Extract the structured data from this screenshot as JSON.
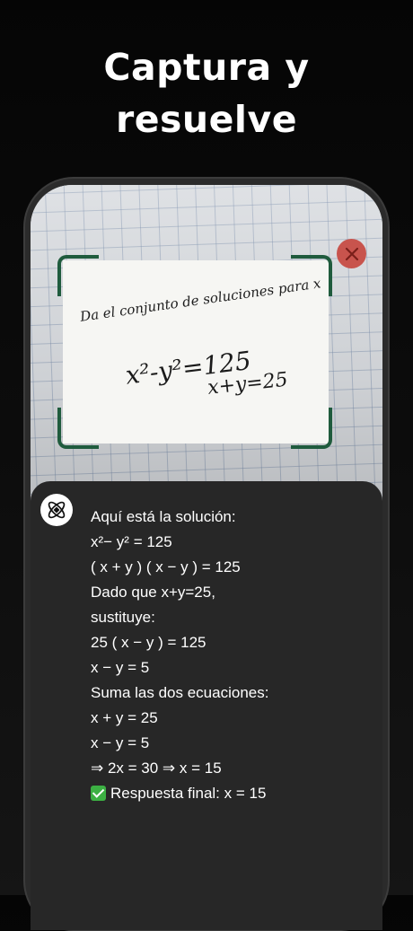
{
  "headline": {
    "line1": "Captura y",
    "line2": "resuelve"
  },
  "photo": {
    "prompt": "Da el conjunto de soluciones para x",
    "equation1": "x²-y²=125",
    "equation2": "x+y=25"
  },
  "close_icon": "close-icon",
  "assistant_icon": "atom-icon",
  "colors": {
    "scanner_frame": "#1f5b3d",
    "close_button": "#c8544d",
    "sheet": "#272727",
    "check": "#3cb043"
  },
  "solution": {
    "lines": [
      "Aquí está la solución:",
      "x²− y² = 125",
      "( x + y ) ( x − y ) = 125",
      "Dado que x+y=25,",
      "sustituye:",
      "25 ( x − y ) = 125",
      "x − y = 5",
      "Suma las dos ecuaciones:",
      "x + y = 25",
      "x − y = 5",
      "⇒ 2x = 30 ⇒ x = 15"
    ],
    "final": "Respuesta final: x = 15",
    "final_icon": "check-mark-icon"
  }
}
